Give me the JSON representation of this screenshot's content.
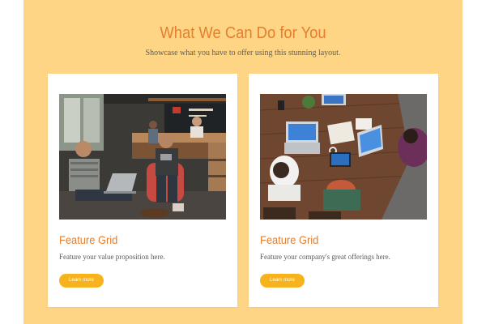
{
  "section": {
    "title": "What We Can Do for You",
    "subtitle": "Showcase what you have to offer using this stunning layout."
  },
  "cards": [
    {
      "image": "cafe-photo-two-men-laptop",
      "title": "Feature Grid",
      "description": "Feature your value proposition here.",
      "button_label": "Learn more"
    },
    {
      "image": "overhead-photo-team-laptops-tablets",
      "title": "Feature Grid",
      "description": "Feature your company's great offerings here.",
      "button_label": "Learn more"
    }
  ],
  "colors": {
    "panel_background": "#fed584",
    "accent_orange": "#e57e2e",
    "button_yellow": "#f7b31d",
    "card_background": "#ffffff"
  }
}
